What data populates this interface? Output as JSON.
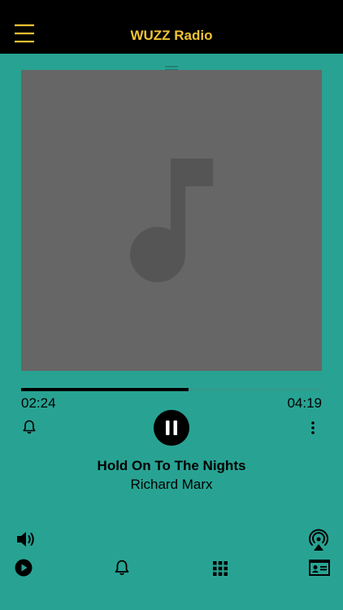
{
  "header": {
    "title": "WUZZ Radio",
    "menu_icon": "hamburger-menu-icon",
    "accent_color": "#f1c232"
  },
  "player": {
    "artwork_icon": "music-note-icon",
    "progress": 0.5574,
    "elapsed": "02:24",
    "total": "04:19",
    "state": "playing",
    "play_pause_icon": "pause-icon",
    "left_action_icon": "bell-icon",
    "right_action_icon": "more-vertical-icon"
  },
  "track": {
    "title": "Hold On To The Nights",
    "artist": "Richard Marx"
  },
  "controls": {
    "volume_icon": "volume-icon",
    "airplay_icon": "airplay-icon"
  },
  "bottom_nav": {
    "items": [
      {
        "icon": "play-circle-icon"
      },
      {
        "icon": "bell-icon"
      },
      {
        "icon": "grid-icon"
      },
      {
        "icon": "contact-card-icon"
      }
    ]
  },
  "colors": {
    "background": "#28a393",
    "header": "#000000",
    "artwork_bg": "#666666",
    "artwork_icon": "#555555"
  }
}
